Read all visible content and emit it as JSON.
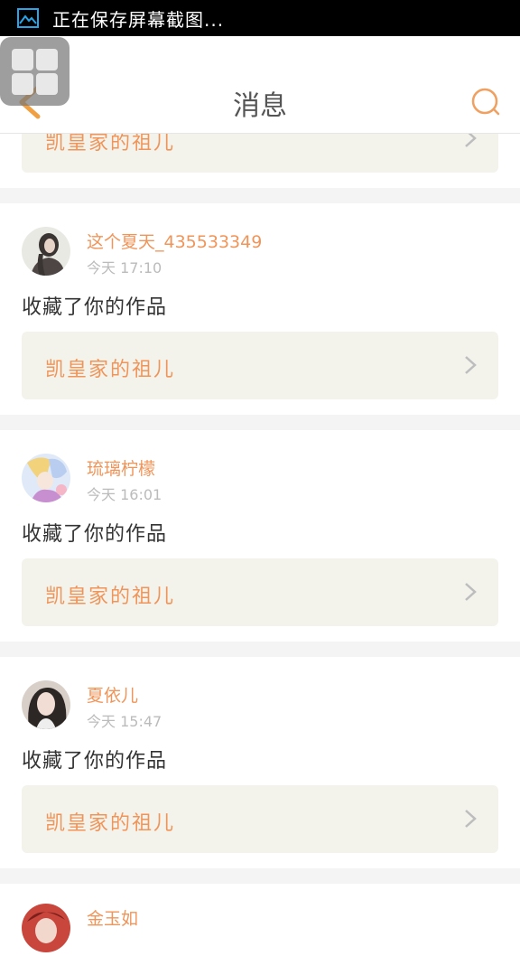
{
  "status_bar": {
    "text": "正在保存屏幕截图..."
  },
  "header": {
    "title": "消息"
  },
  "colors": {
    "accent": "#f0955a",
    "card_bg": "#f3f3ec",
    "time": "#bbbbbb"
  },
  "partial_top": {
    "work_title": "凯皇家的祖儿"
  },
  "messages": [
    {
      "username": "这个夏天_435533349",
      "time": "今天 17:10",
      "action": "收藏了你的作品",
      "work_title": "凯皇家的祖儿"
    },
    {
      "username": "琉璃柠檬",
      "time": "今天 16:01",
      "action": "收藏了你的作品",
      "work_title": "凯皇家的祖儿"
    },
    {
      "username": "夏依儿",
      "time": "今天 15:47",
      "action": "收藏了你的作品",
      "work_title": "凯皇家的祖儿"
    }
  ],
  "partial_bottom": {
    "username": "金玉如"
  }
}
